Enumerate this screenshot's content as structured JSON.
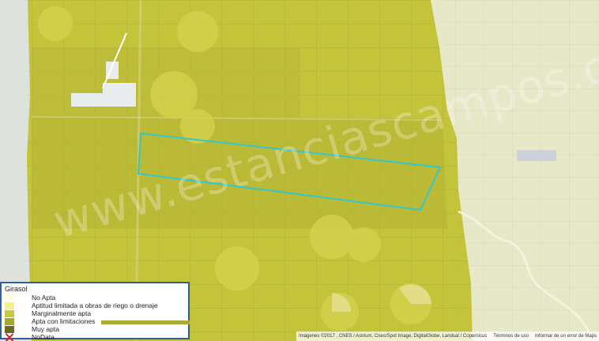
{
  "map": {
    "watermark": "www.estanciascampos.com.ar",
    "colors": {
      "no_apta": "#ffffdd",
      "aptitud_limitada": "#f2f28a",
      "marginalmente_apta": "#c8c838",
      "apta_con_limitaciones": "#a6a82a",
      "muy_apta": "#6a6a20",
      "parcel_outline": "#33c6cc"
    }
  },
  "legend": {
    "title": "Girasol",
    "items": [
      {
        "label": "No Apta",
        "color": "#ffffdd",
        "icon": "swatch"
      },
      {
        "label": "Aptitud limitada a obras de riego o drenaje",
        "color": "#f2f28a",
        "icon": "swatch"
      },
      {
        "label": "Marginalmente apta",
        "color": "#c8c838",
        "icon": "swatch"
      },
      {
        "label": "Apta con limitaciones",
        "color": "#a6a82a",
        "icon": "swatch"
      },
      {
        "label": "Muy apta",
        "color": "#6a6a20",
        "icon": "swatch"
      },
      {
        "label": "NoData",
        "color": "#d42020",
        "icon": "red-x-icon"
      }
    ]
  },
  "attribution": {
    "imagery": "Imágenes ©2017 , CNES / Astrium, Cnes/Spot Image, DigitalGlobe, Landsat / Copernicus",
    "terms": "Términos de uso",
    "report": "Informar de un error de Maps"
  }
}
